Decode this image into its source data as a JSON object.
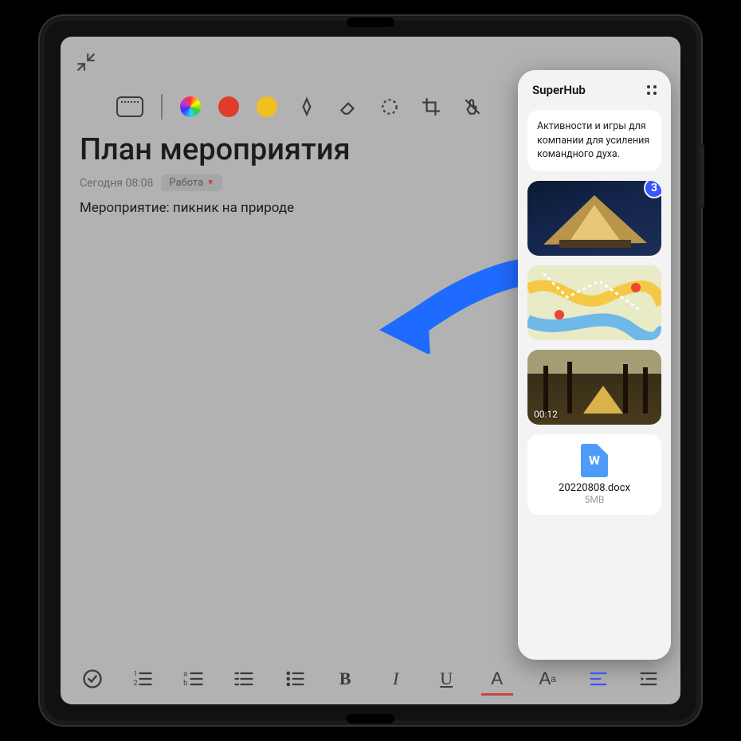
{
  "note": {
    "title": "План мероприятия",
    "timestamp": "Сегодня 08:08",
    "tag": "Работа",
    "body": "Мероприятие: пикник на природе"
  },
  "toolbar": {
    "colors": [
      "rainbow",
      "red",
      "yellow"
    ]
  },
  "superhub": {
    "title": "SuperHub",
    "text_card": "Активности и игры для компании для усиления командного духа.",
    "photo_badge": "3",
    "video_timestamp": "00:12",
    "doc": {
      "name": "20220808.docx",
      "size": "5MB",
      "icon_letter": "W"
    }
  },
  "format_labels": {
    "bold": "B",
    "italic": "I",
    "underline": "U",
    "color": "A",
    "size": "A"
  }
}
